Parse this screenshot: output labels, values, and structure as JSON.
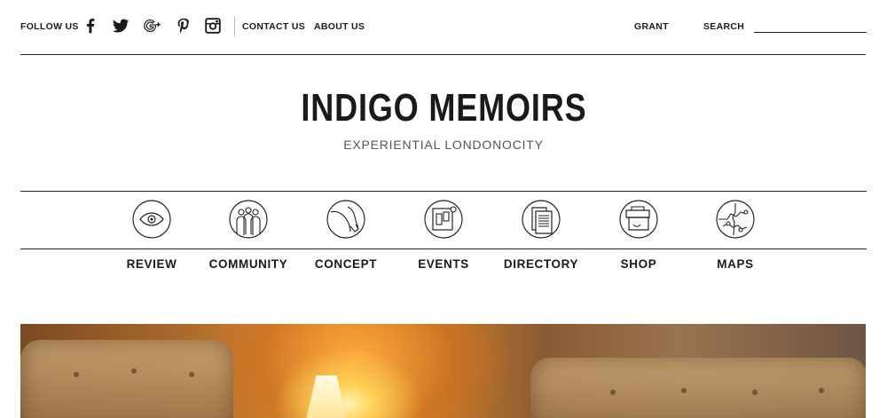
{
  "header": {
    "follow_label": "FOLLOW US",
    "social": [
      "facebook-icon",
      "twitter-icon",
      "google-plus-icon",
      "pinterest-icon",
      "instagram-icon"
    ],
    "links": {
      "contact": "CONTACT US",
      "about": "ABOUT US",
      "grant": "GRANT"
    },
    "search": {
      "label": "SEARCH",
      "value": ""
    }
  },
  "brand": {
    "title": "INDIGO MEMOIRS",
    "tagline": "EXPERIENTIAL LONDONOCITY"
  },
  "nav": {
    "items": [
      {
        "label": "REVIEW",
        "icon": "eye-icon"
      },
      {
        "label": "COMMUNITY",
        "icon": "people-icon"
      },
      {
        "label": "CONCEPT",
        "icon": "concept-icon"
      },
      {
        "label": "EVENTS",
        "icon": "calendar-icon"
      },
      {
        "label": "DIRECTORY",
        "icon": "directory-icon"
      },
      {
        "label": "SHOP",
        "icon": "shopping-bag-icon"
      },
      {
        "label": "MAPS",
        "icon": "map-icon"
      }
    ]
  },
  "colors": {
    "text": "#1a1a1a",
    "rule": "#222222",
    "hero_accent": "#e79b34"
  }
}
